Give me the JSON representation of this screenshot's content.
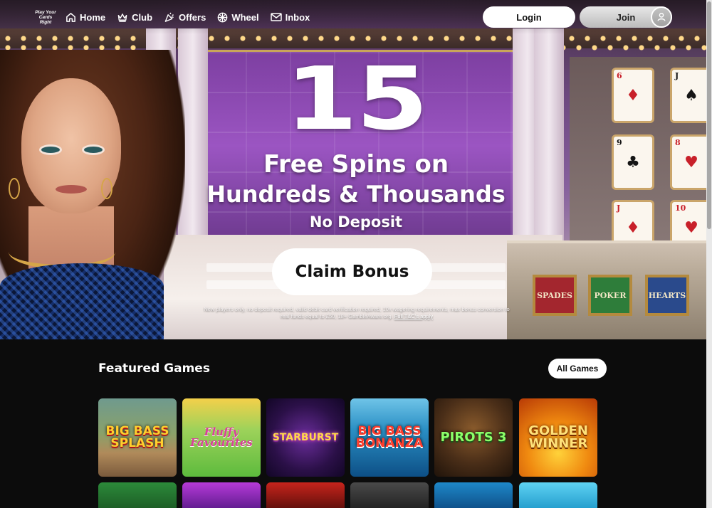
{
  "brand": {
    "logo_text": "Play Your Cards Right"
  },
  "nav": {
    "items": [
      {
        "label": "Home",
        "icon": "home-icon"
      },
      {
        "label": "Club",
        "icon": "crown-icon"
      },
      {
        "label": "Offers",
        "icon": "party-popper-icon"
      },
      {
        "label": "Wheel",
        "icon": "wheel-icon"
      },
      {
        "label": "Inbox",
        "icon": "envelope-icon"
      }
    ],
    "login_label": "Login",
    "join_label": "Join",
    "account_icon": "user-icon"
  },
  "hero": {
    "number": "15",
    "line1": "Free Spins on",
    "line2": "Hundreds & Thousands",
    "subline": "No Deposit",
    "cta_label": "Claim Bonus",
    "terms_text": "New players only, no deposit required, valid debit card verification required, 10x wagering requirements, max bonus conversion to real funds equal to £50, 18+ GambleAware.org.",
    "terms_link": "Full T&C's apply",
    "desk_signs": [
      "SPADES",
      "POKER",
      "HEARTS"
    ],
    "cards": [
      {
        "rank": "6",
        "suit": "♦",
        "color": "red"
      },
      {
        "rank": "J",
        "suit": "♠",
        "color": "black"
      },
      {
        "rank": "9",
        "suit": "♣",
        "color": "black"
      },
      {
        "rank": "8",
        "suit": "♥",
        "color": "red"
      },
      {
        "rank": "J",
        "suit": "♦",
        "color": "red"
      },
      {
        "rank": "10",
        "suit": "♥",
        "color": "red"
      }
    ]
  },
  "featured": {
    "title": "Featured Games",
    "all_games_label": "All Games",
    "games": [
      {
        "name": "BIG BASS SPLASH"
      },
      {
        "name": "Fluffy Favourites"
      },
      {
        "name": "STARBURST"
      },
      {
        "name": "BIG BASS BONANZA"
      },
      {
        "name": "PIROTS 3"
      },
      {
        "name": "GOLDEN WINNER"
      }
    ]
  },
  "colors": {
    "accent_white": "#ffffff",
    "page_background": "#0c0c0c",
    "hero_purple": "#9b55c2"
  }
}
